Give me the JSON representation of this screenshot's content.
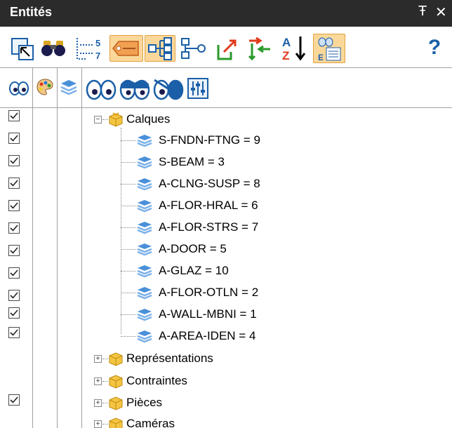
{
  "window": {
    "title": "Entités",
    "pin_glyph": "Ŧ",
    "close_glyph": "✕"
  },
  "toolbar1": {
    "tools": [
      {
        "name": "select-entity-tool",
        "icon": "select-arrow-icon"
      },
      {
        "name": "find-tool",
        "icon": "binoculars-icon"
      },
      {
        "name": "count-tool",
        "icon": "numbered-list-icon",
        "top_number": "5",
        "bottom_number": "7"
      },
      {
        "name": "tag-tool",
        "icon": "tag-icon",
        "active": true
      },
      {
        "name": "tree-view-tool",
        "icon": "tree-hierarchy-icon",
        "active": true
      },
      {
        "name": "tree-flat-tool",
        "icon": "tree-flat-icon"
      },
      {
        "name": "export-tool",
        "icon": "export-arrow-icon"
      },
      {
        "name": "move-tool",
        "icon": "move-arrows-icon"
      },
      {
        "name": "sort-az-tool",
        "icon": "sort-az-icon",
        "letter_top": "A",
        "letter_bottom": "Z"
      },
      {
        "name": "layer-list-tool",
        "icon": "layer-list-icon",
        "active": true
      },
      {
        "name": "help-tool",
        "icon": "help-icon",
        "glyph": "?"
      }
    ]
  },
  "toolbar2": {
    "columns": [
      "visibility-column-icon",
      "color-column-icon",
      "layer-column-icon"
    ],
    "tools": [
      {
        "name": "show-all-tool",
        "icon": "eyes-open-icon"
      },
      {
        "name": "hide-all-tool",
        "icon": "eyes-half-closed-icon"
      },
      {
        "name": "invert-visibility-tool",
        "icon": "eye-invert-icon"
      },
      {
        "name": "settings-tool",
        "icon": "sliders-icon"
      }
    ]
  },
  "tree": {
    "root_calques": {
      "label": "Calques",
      "expanded": true
    },
    "layers": [
      {
        "label": "S-FNDN-FTNG = 9",
        "checked": true
      },
      {
        "label": "S-BEAM = 3",
        "checked": true
      },
      {
        "label": "A-CLNG-SUSP = 8",
        "checked": true
      },
      {
        "label": "A-FLOR-HRAL = 6",
        "checked": true
      },
      {
        "label": "A-FLOR-STRS = 7",
        "checked": true
      },
      {
        "label": "A-DOOR = 5",
        "checked": true
      },
      {
        "label": "A-GLAZ = 10",
        "checked": true
      },
      {
        "label": "A-FLOR-OTLN = 2",
        "checked": true
      },
      {
        "label": "A-WALL-MBNI = 1",
        "checked": true
      },
      {
        "label": "A-AREA-IDEN = 4",
        "checked": true
      }
    ],
    "groups": [
      {
        "label": "Représentations",
        "expanded": false,
        "checked": false
      },
      {
        "label": "Contraintes",
        "expanded": false,
        "checked": false
      },
      {
        "label": "Pièces",
        "expanded": false,
        "checked": true
      },
      {
        "label": "Caméras",
        "expanded": false,
        "checked": false
      }
    ]
  },
  "colors": {
    "titlebar_bg": "#2b2b2b",
    "active_tool_bg": "#fbd89a",
    "grid_line": "#a0a0a0",
    "folder_yellow": "#f4c542",
    "layer_blue": "#4a90d9"
  }
}
